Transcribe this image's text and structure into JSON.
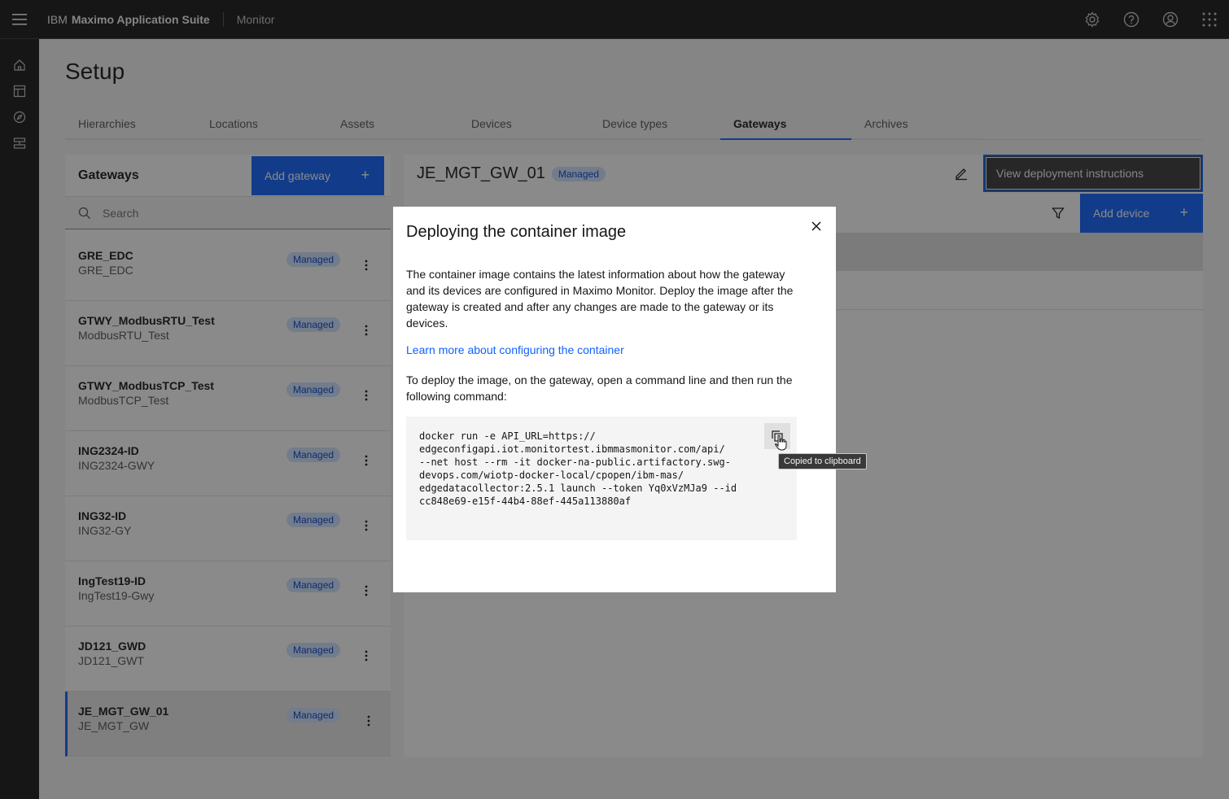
{
  "header": {
    "brand_ibm": "IBM",
    "brand_product": "Maximo Application Suite",
    "module": "Monitor",
    "actions": [
      {
        "icon": "settings-icon"
      },
      {
        "icon": "help-icon"
      },
      {
        "icon": "user-icon"
      },
      {
        "icon": "app-switcher-icon"
      }
    ]
  },
  "rail": {
    "items": [
      "home-icon",
      "dashboard-icon",
      "compass-icon",
      "setup-icon"
    ]
  },
  "page": {
    "title": "Setup"
  },
  "tabs": [
    {
      "label": "Hierarchies",
      "active": false
    },
    {
      "label": "Locations",
      "active": false
    },
    {
      "label": "Assets",
      "active": false
    },
    {
      "label": "Devices",
      "active": false
    },
    {
      "label": "Device types",
      "active": false
    },
    {
      "label": "Gateways",
      "active": true
    },
    {
      "label": "Archives",
      "active": false
    }
  ],
  "gateways": {
    "title": "Gateways",
    "add_label": "Add gateway",
    "add_icon": "+",
    "search_placeholder": "Search",
    "items": [
      {
        "name": "GRE_EDC",
        "sub": "GRE_EDC",
        "badge": "Managed"
      },
      {
        "name": "GTWY_ModbusRTU_Test",
        "sub": "ModbusRTU_Test",
        "badge": "Managed"
      },
      {
        "name": "GTWY_ModbusTCP_Test",
        "sub": "ModbusTCP_Test",
        "badge": "Managed"
      },
      {
        "name": "ING2324-ID",
        "sub": "ING2324-GWY",
        "badge": "Managed"
      },
      {
        "name": "ING32-ID",
        "sub": "ING32-GY",
        "badge": "Managed"
      },
      {
        "name": "IngTest19-ID",
        "sub": "IngTest19-Gwy",
        "badge": "Managed"
      },
      {
        "name": "JD121_GWD",
        "sub": "JD121_GWT",
        "badge": "Managed"
      },
      {
        "name": "JE_MGT_GW_01",
        "sub": "JE_MGT_GW",
        "badge": "Managed",
        "selected": true
      }
    ]
  },
  "detail": {
    "title": "JE_MGT_GW_01",
    "badge": "Managed",
    "view_deploy_label": "View deployment instructions",
    "add_device_label": "Add device",
    "add_device_icon": "+"
  },
  "modal": {
    "title": "Deploying the container image",
    "body": "The container image contains the latest information about how the gateway and its devices are configured in Maximo Monitor. Deploy the image after the gateway is created and after any changes are made to the gateway or its devices.",
    "link": "Learn more about configuring the container",
    "body2": "To deploy the image, on the gateway, open a command line and then run the following command:",
    "code": "docker run -e API_URL=https://\nedgeconfigapi.iot.monitortest.ibmmasmonitor.com/api/\n--net host --rm -it docker-na-public.artifactory.swg-\ndevops.com/wiotp-docker-local/cpopen/ibm-mas/\nedgedatacollector:2.5.1 launch --token Yq0xVzMJa9 --id\ncc848e69-e15f-44b4-88ef-445a113880af",
    "tooltip": "Copied to clipboard"
  },
  "colors": {
    "accent": "#0f62fe",
    "header_bg": "#161616",
    "badge_bg": "#d0e2ff",
    "badge_fg": "#0043ce"
  }
}
